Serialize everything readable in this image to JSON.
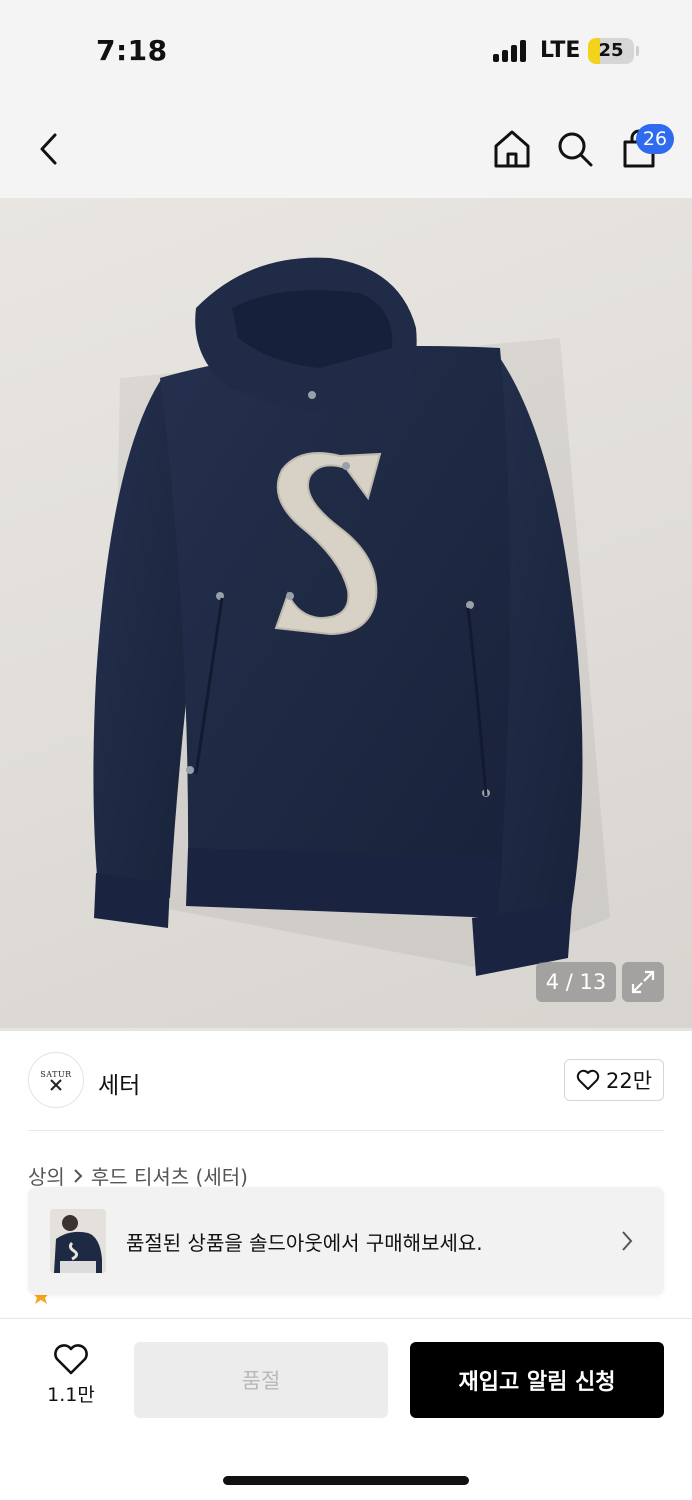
{
  "status_bar": {
    "time": "7:18",
    "network": "LTE",
    "battery_level": "25",
    "battery_fraction": 0.25,
    "battery_color": "#f2d21b"
  },
  "nav": {
    "back_icon": "chevron-left-icon",
    "home_icon": "home-icon",
    "search_icon": "search-icon",
    "cart_icon": "shopping-bag-icon",
    "cart_count": "26",
    "badge_color": "#2e6bf0"
  },
  "gallery": {
    "counter": "4 / 13",
    "product_color": "#1e2a44",
    "patch_color": "#d7d1c6"
  },
  "brand": {
    "logo_text": "SATUR",
    "name": "세터",
    "like_count": "22만"
  },
  "breadcrumb": {
    "category": "상의",
    "subcategory": "후드 티셔츠 (세터)"
  },
  "soldout_banner": {
    "message": "품절된 상품을 솔드아웃에서 구매해보세요."
  },
  "bottom_bar": {
    "like_count": "1.1만",
    "soldout_label": "품절",
    "restock_label": "재입고 알림 신청"
  }
}
